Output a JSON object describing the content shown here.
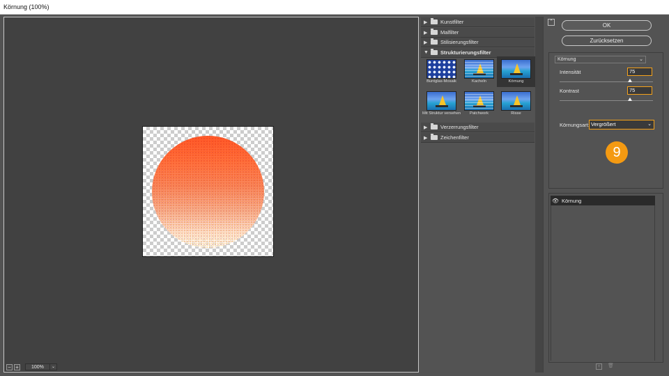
{
  "window": {
    "title": "Körnung (100%)"
  },
  "preview": {
    "zoom_value": "100%",
    "zoom_out": "−",
    "zoom_in": "+"
  },
  "gallery": {
    "categories": [
      {
        "label": "Kunstfilter",
        "state": "collapsed"
      },
      {
        "label": "Malfilter",
        "state": "collapsed"
      },
      {
        "label": "Stilisierungsfilter",
        "state": "collapsed"
      },
      {
        "label": "Strukturierungsfilter",
        "state": "expanded"
      },
      {
        "label": "Verzerrungsfilter",
        "state": "collapsed"
      },
      {
        "label": "Zeichenfilter",
        "state": "collapsed"
      }
    ],
    "thumbnails": [
      {
        "label": "Buntglas-Mosaik",
        "selected": false
      },
      {
        "label": "Kacheln",
        "selected": false
      },
      {
        "label": "Körnung",
        "selected": true
      },
      {
        "label": "Mit Struktur versehen",
        "selected": false
      },
      {
        "label": "Patchwork",
        "selected": false
      },
      {
        "label": "Risse",
        "selected": false
      }
    ],
    "icons": {
      "collapsed": "▶",
      "expanded": "▼"
    }
  },
  "buttons": {
    "ok": "OK",
    "reset": "Zurücksetzen",
    "collapse_icon": "⌃"
  },
  "settings": {
    "filter_select": "Körnung",
    "intensity_label": "Intensität",
    "intensity_value": "75",
    "intensity_level": 75,
    "contrast_label": "Kontrast",
    "contrast_value": "75",
    "contrast_level": 75,
    "grain_type_label": "Körnungsart:",
    "grain_type_value": "Vergrößert",
    "dropdown_arrow": "⌄"
  },
  "badge": {
    "number": "9",
    "color": "#f49a12"
  },
  "layers": {
    "items": [
      {
        "label": "Körnung",
        "icon": "eye-icon"
      }
    ]
  },
  "colors": {
    "accent": "#f6a21a",
    "dialog_bg": "#535353",
    "preview_bg": "#414141"
  }
}
